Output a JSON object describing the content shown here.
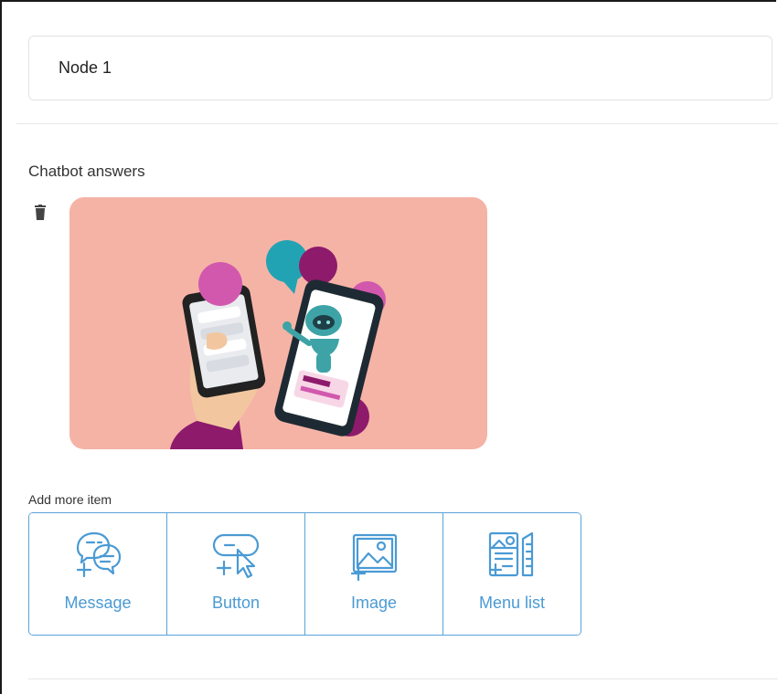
{
  "node": {
    "name": "Node 1"
  },
  "section": {
    "title": "Chatbot answers"
  },
  "answer": {
    "type": "image",
    "delete_icon": "trash-icon",
    "background": "#f5b3a6"
  },
  "add_more": {
    "label": "Add more item",
    "items": [
      {
        "label": "Message",
        "icon": "message-add-icon"
      },
      {
        "label": "Button",
        "icon": "button-add-icon"
      },
      {
        "label": "Image",
        "icon": "image-add-icon"
      },
      {
        "label": "Menu list",
        "icon": "menu-list-add-icon"
      }
    ]
  },
  "colors": {
    "accent": "#4a9ad4",
    "border": "#5aa3d8"
  }
}
